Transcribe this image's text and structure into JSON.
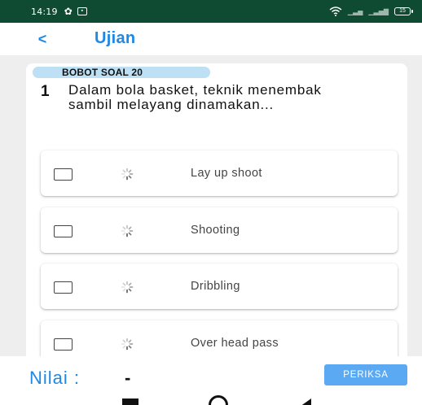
{
  "status_bar": {
    "time": "14:19",
    "battery": "15",
    "icons": [
      "gear-icon",
      "notification-box-icon",
      "wifi-icon",
      "signal-icon",
      "battery-icon"
    ]
  },
  "header": {
    "back_glyph": "<",
    "title": "Ujian"
  },
  "question": {
    "weight_badge": "BOBOT SOAL 20",
    "number": "1",
    "text": "Dalam bola basket, teknik menembak sambil melayang dinamakan..."
  },
  "options": [
    {
      "label": "Lay up shoot",
      "checked": false
    },
    {
      "label": "Shooting",
      "checked": false
    },
    {
      "label": "Dribbling",
      "checked": false
    },
    {
      "label": "Over head pass",
      "checked": false
    }
  ],
  "bottom": {
    "score_label": "Nilai :",
    "score_value": "-",
    "check_button": "PERIKSA"
  },
  "colors": {
    "status_bar": "#0f4a33",
    "accent": "#1e88e5",
    "badge": "#bde0f5",
    "button": "#5aa9f2",
    "content_bg": "#eeeeee"
  },
  "nav": {
    "icons": [
      "recent-apps-icon",
      "home-icon",
      "back-icon"
    ]
  }
}
